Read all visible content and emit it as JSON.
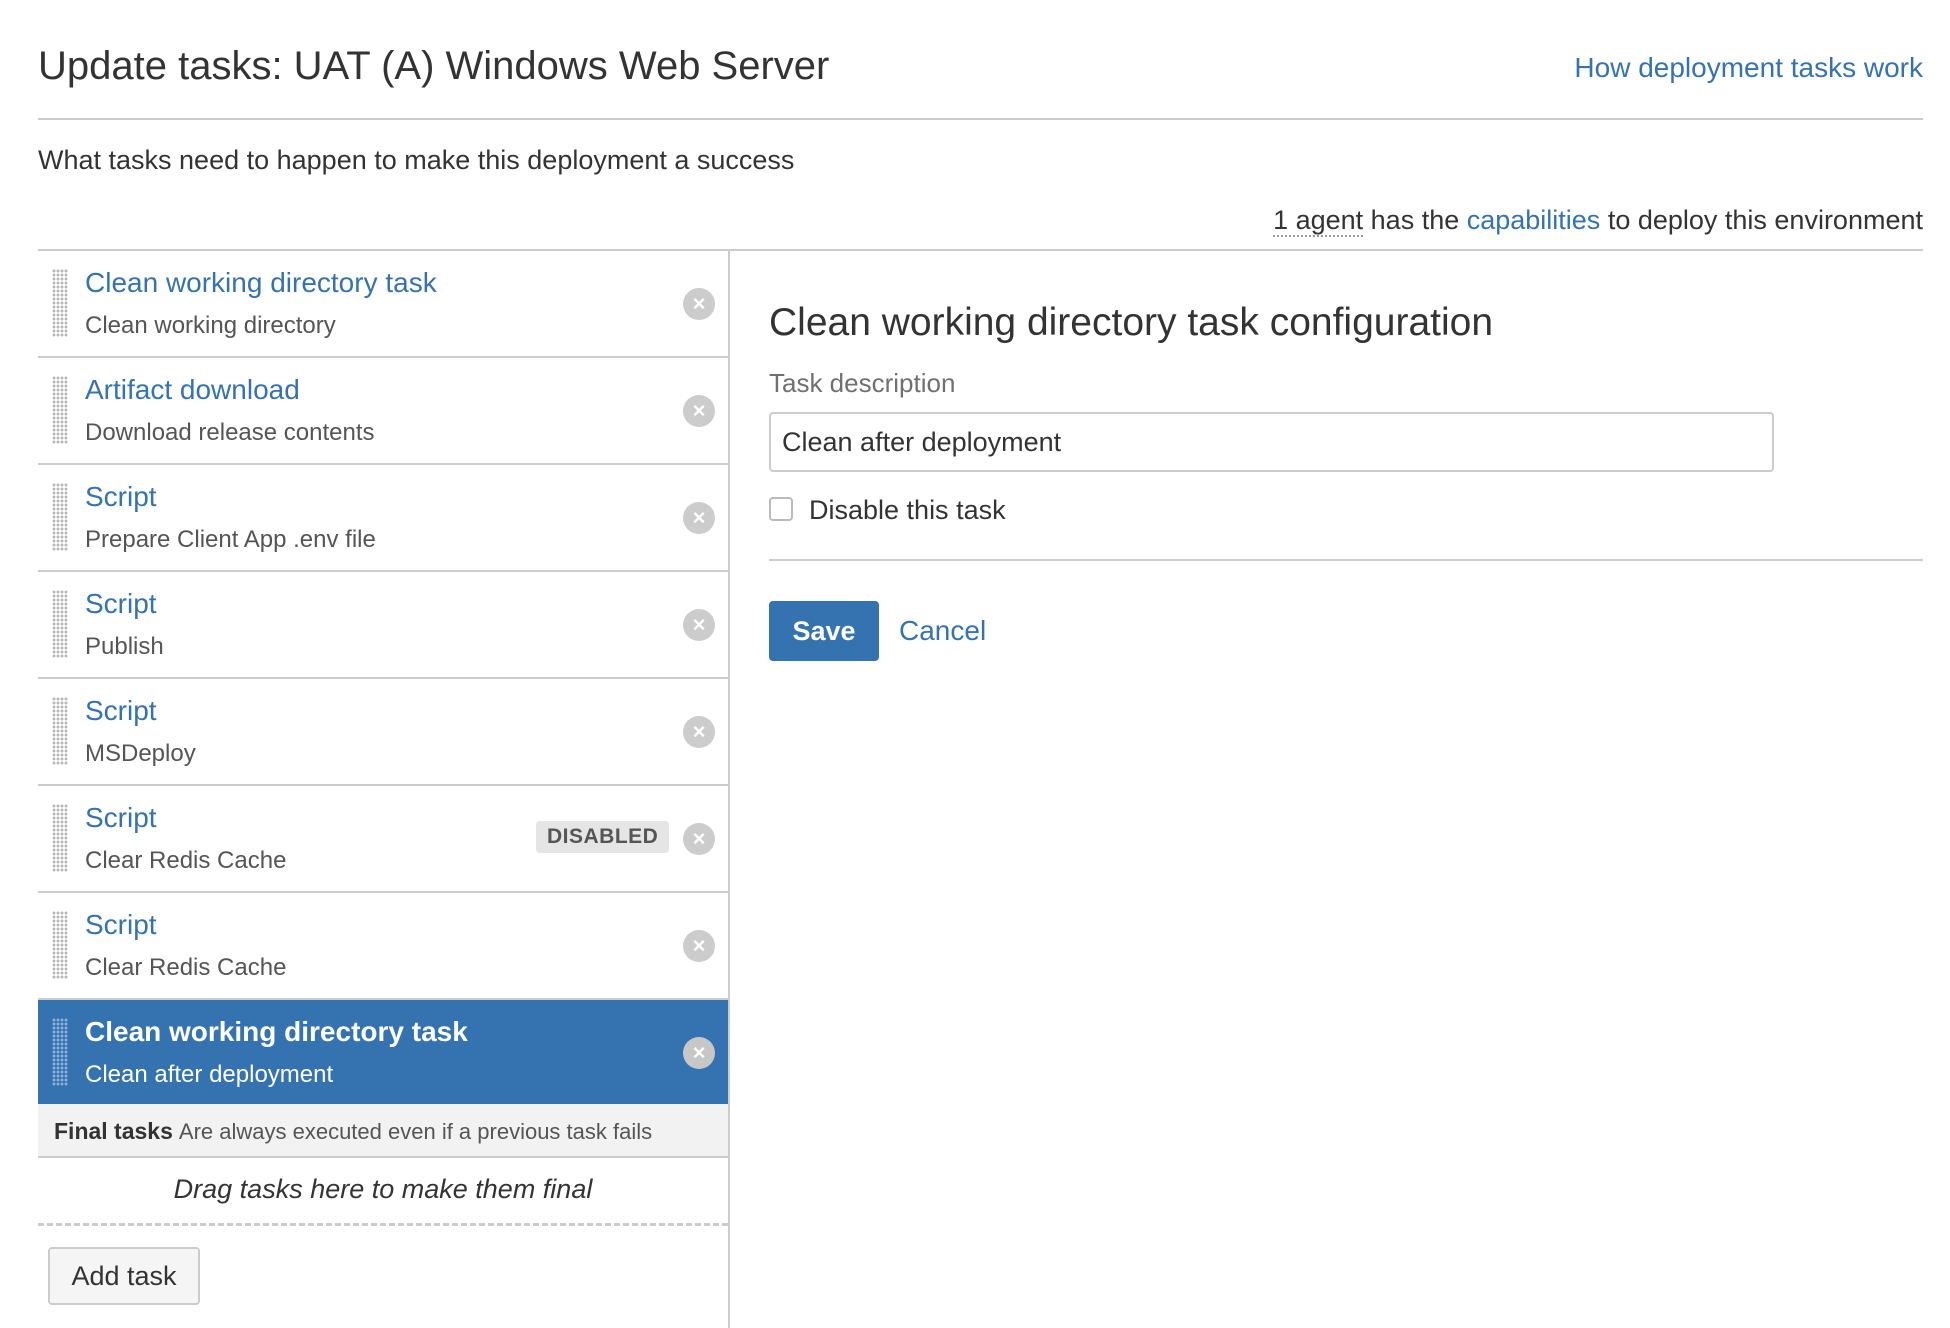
{
  "header": {
    "title": "Update tasks: UAT (A) Windows Web Server",
    "help_link": "How deployment tasks work"
  },
  "subtitle": "What tasks need to happen to make this deployment a success",
  "agents": {
    "count_text": "1 agent",
    "prefix": " has the ",
    "capabilities_link": "capabilities",
    "suffix": " to deploy this environment"
  },
  "tasks": [
    {
      "name": "Clean working directory task",
      "description": "Clean working directory"
    },
    {
      "name": "Artifact download",
      "description": "Download release contents"
    },
    {
      "name": "Script",
      "description": "Prepare Client App .env file"
    },
    {
      "name": "Script",
      "description": "Publish"
    },
    {
      "name": "Script",
      "description": "MSDeploy"
    },
    {
      "name": "Script",
      "description": "Clear Redis Cache",
      "badge": "DISABLED"
    },
    {
      "name": "Script",
      "description": "Clear Redis Cache"
    },
    {
      "name": "Clean working directory task",
      "description": "Clean after deployment",
      "selected": true
    }
  ],
  "remove_glyph": "×",
  "final_tasks": {
    "title": "Final tasks",
    "description": "Are always executed even if a previous task fails",
    "drop_hint": "Drag tasks here to make them final"
  },
  "add_task_label": "Add task",
  "config": {
    "title": "Clean working directory task configuration",
    "field_label": "Task description",
    "description_value": "Clean after deployment",
    "disable_label": "Disable this task",
    "disable_checked": false,
    "save_label": "Save",
    "cancel_label": "Cancel"
  },
  "colors": {
    "link": "#3572b0",
    "selected_bg": "#3572b0",
    "border": "#cccccc"
  }
}
